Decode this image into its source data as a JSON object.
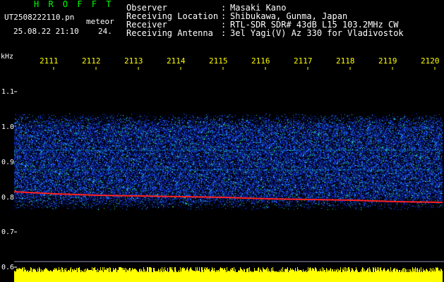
{
  "header": {
    "title": "H R O F F T",
    "filename": "UT2508222110.pn",
    "mode": "meteor",
    "datetime": "25.08.22 21:10",
    "count": "24."
  },
  "info": [
    {
      "label": "Observer",
      "value": "Masaki Kano"
    },
    {
      "label": "Receiving Location",
      "value": "Shibukawa, Gunma, Japan"
    },
    {
      "label": "Receiver",
      "value": "RTL-SDR SDR# 43dB L15 103.2MHz CW"
    },
    {
      "label": "Receiving Antenna",
      "value": "3el Yagi(V) Az 330 for Vladivostok"
    }
  ],
  "info_separator": ":",
  "axis": {
    "y_unit": "kHz",
    "y_ticks": [
      "1.1",
      "1.0",
      "0.9",
      "0.8",
      "0.7",
      "0.6"
    ],
    "x_ticks": [
      "2111",
      "2112",
      "2113",
      "2114",
      "2115",
      "2116",
      "2117",
      "2118",
      "2119",
      "2120"
    ]
  },
  "colors": {
    "header_green": "#00ff00",
    "label_white": "#ffffff",
    "axis_yellow": "#ffff00",
    "trace_red": "#ff2020",
    "noise_blue": "#1040ff",
    "bar_yellow": "#ffff00"
  }
}
